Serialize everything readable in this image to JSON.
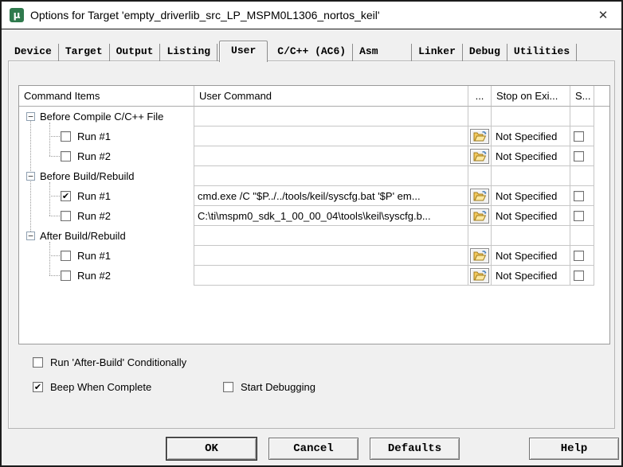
{
  "window": {
    "title": "Options for Target 'empty_driverlib_src_LP_MSPM0L1306_nortos_keil'",
    "close_glyph": "✕",
    "app_icon_glyph": "µ"
  },
  "tabs": [
    {
      "label": "Device"
    },
    {
      "label": "Target"
    },
    {
      "label": "Output"
    },
    {
      "label": "Listing"
    },
    {
      "label": "User",
      "active": true
    },
    {
      "label": "C/C++ (AC6)"
    },
    {
      "label": "Asm"
    },
    {
      "label": "Linker"
    },
    {
      "label": "Debug"
    },
    {
      "label": "Utilities"
    }
  ],
  "table": {
    "headers": {
      "command_items": "Command Items",
      "user_command": "User Command",
      "browse": "...",
      "stop_on_exit": "Stop on Exi...",
      "s": "S..."
    },
    "rows": [
      {
        "type": "group",
        "label": "Before Compile C/C++ File"
      },
      {
        "type": "run",
        "label": "Run #1",
        "checked": false,
        "command": "",
        "stop": "Not Specified",
        "s_checked": false
      },
      {
        "type": "run",
        "label": "Run #2",
        "checked": false,
        "command": "",
        "stop": "Not Specified",
        "s_checked": false
      },
      {
        "type": "group",
        "label": "Before Build/Rebuild"
      },
      {
        "type": "run",
        "label": "Run #1",
        "checked": true,
        "command": "cmd.exe /C \"$P../../tools/keil/syscfg.bat '$P' em...",
        "stop": "Not Specified",
        "s_checked": false
      },
      {
        "type": "run",
        "label": "Run #2",
        "checked": false,
        "command": "C:\\ti\\mspm0_sdk_1_00_00_04\\tools\\keil\\syscfg.b...",
        "stop": "Not Specified",
        "s_checked": false
      },
      {
        "type": "group",
        "label": "After Build/Rebuild"
      },
      {
        "type": "run",
        "label": "Run #1",
        "checked": false,
        "command": "",
        "stop": "Not Specified",
        "s_checked": false
      },
      {
        "type": "run",
        "label": "Run #2",
        "checked": false,
        "command": "",
        "stop": "Not Specified",
        "s_checked": false
      }
    ]
  },
  "options": {
    "run_after_build": {
      "label": "Run 'After-Build' Conditionally",
      "checked": false
    },
    "beep": {
      "label": "Beep When Complete",
      "checked": true
    },
    "start_debug": {
      "label": "Start Debugging",
      "checked": false
    }
  },
  "buttons": {
    "ok": "OK",
    "cancel": "Cancel",
    "defaults": "Defaults",
    "help": "Help"
  },
  "icons": {
    "checkmark": "✔",
    "expander_collapse": "−",
    "browse": "open-folder"
  }
}
